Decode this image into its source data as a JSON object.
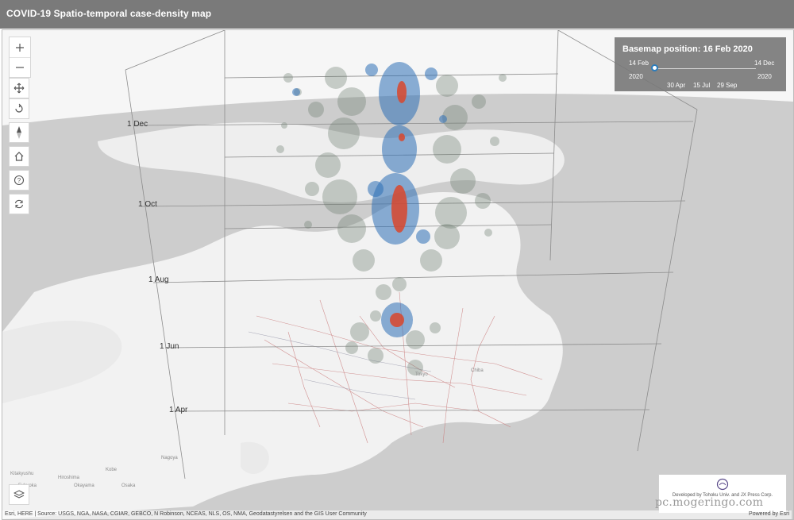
{
  "app": {
    "title": "COVID-19 Spatio-temporal case-density map"
  },
  "controls": {
    "zoom_in": "zoom-in-icon",
    "zoom_out": "zoom-out-icon",
    "pan": "pan-icon",
    "rotate": "rotate-icon",
    "compass": "compass-icon",
    "home": "home-icon",
    "help": "help-icon",
    "refresh": "refresh-icon",
    "layers": "layers-icon"
  },
  "time_axis": {
    "labels": [
      "1 Dec",
      "1 Oct",
      "1 Aug",
      "1 Jun",
      "1 Apr"
    ]
  },
  "basemap_slider": {
    "title": "Basemap position: 16 Feb 2020",
    "start_day": "14 Feb",
    "start_year": "2020",
    "end_day": "14 Dec",
    "end_year": "2020",
    "ticks": [
      "30 Apr",
      "15 Jul",
      "29 Sep"
    ],
    "value_fraction": 0.007
  },
  "credit": {
    "text": "Developed by Tohoku Univ. and JX Press Corp."
  },
  "watermark": "pc.mogeringo.com",
  "attribution": {
    "left": "Esri, HERE | Source: USGS, NGA, NASA, CGIAR, GEBCO, N Robinson, NCEAS, NLS, OS, NMA, Geodatastyrelsen and the GIS User Community",
    "right": "Powered by Esri"
  },
  "colors": {
    "titlebar": "#7a7a7a",
    "density_high": "#d9472b",
    "density_mid": "#2e6fb7",
    "density_low": "#6b7a6e"
  }
}
